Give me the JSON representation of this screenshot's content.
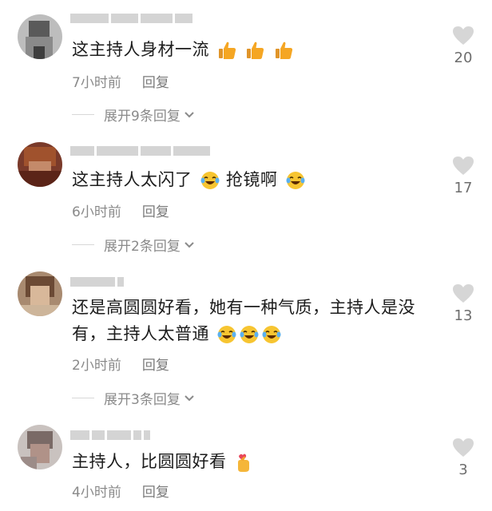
{
  "comments": [
    {
      "text": "这主持人身材一流",
      "emojis": [
        "thumbs-up-icon",
        "thumbs-up-icon",
        "thumbs-up-icon"
      ],
      "time": "7小时前",
      "reply_label": "回复",
      "expand_label": "展开9条回复",
      "likes": "20"
    },
    {
      "text_part1": "这主持人太闪了",
      "text_part2": "抢镜啊",
      "emojis": [
        "laugh-cry-icon",
        "laugh-cry-icon"
      ],
      "time": "6小时前",
      "reply_label": "回复",
      "expand_label": "展开2条回复",
      "likes": "17"
    },
    {
      "text": "还是高圆圆好看，她有一种气质，主持人是没有，主持人太普通",
      "emojis": [
        "laugh-cry-icon",
        "laugh-cry-icon",
        "laugh-cry-icon"
      ],
      "time": "2小时前",
      "reply_label": "回复",
      "expand_label": "展开3条回复",
      "likes": "13"
    },
    {
      "text": "主持人，比圆圆好看",
      "emojis": [
        "finger-heart-icon"
      ],
      "time": "4小时前",
      "reply_label": "回复",
      "likes": "3"
    }
  ],
  "colors": {
    "text": "#1c1c1c",
    "meta": "#8a8a8a",
    "heart": "#d6d6d6",
    "thumb": "#f5a623",
    "laugh": "#f7c531"
  }
}
